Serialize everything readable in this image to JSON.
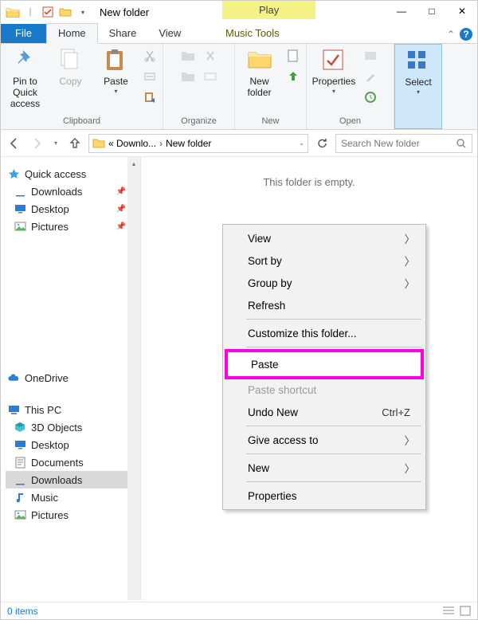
{
  "titlebar": {
    "window_title": "New folder",
    "tools_tab": "Play",
    "controls": {
      "min": "—",
      "max": "□",
      "close": "✕"
    }
  },
  "tabs": {
    "file": "File",
    "home": "Home",
    "share": "Share",
    "view": "View",
    "music_tools": "Music Tools"
  },
  "ribbon": {
    "clipboard": {
      "label": "Clipboard",
      "pin_to_quick": "Pin to Quick access",
      "copy": "Copy",
      "paste": "Paste"
    },
    "organize": {
      "label": "Organize"
    },
    "new": {
      "label": "New",
      "new_folder": "New folder"
    },
    "open": {
      "label": "Open",
      "properties": "Properties"
    },
    "select": {
      "label": "Select"
    }
  },
  "address": {
    "crumbs": [
      "« Downlo...",
      "New folder"
    ],
    "sep": "›"
  },
  "search": {
    "placeholder": "Search New folder"
  },
  "navtree": {
    "quick_access": "Quick access",
    "quick_items": [
      {
        "label": "Downloads"
      },
      {
        "label": "Desktop"
      },
      {
        "label": "Pictures"
      }
    ],
    "onedrive": "OneDrive",
    "this_pc": "This PC",
    "pc_items": [
      {
        "label": "3D Objects"
      },
      {
        "label": "Desktop"
      },
      {
        "label": "Documents"
      },
      {
        "label": "Downloads",
        "selected": true
      },
      {
        "label": "Music"
      },
      {
        "label": "Pictures"
      }
    ]
  },
  "content": {
    "empty_message": "This folder is empty."
  },
  "statusbar": {
    "items": "0 items"
  },
  "context_menu": {
    "view": "View",
    "sort_by": "Sort by",
    "group_by": "Group by",
    "refresh": "Refresh",
    "customize": "Customize this folder...",
    "paste": "Paste",
    "paste_shortcut": "Paste shortcut",
    "undo_new": "Undo New",
    "undo_hotkey": "Ctrl+Z",
    "give_access": "Give access to",
    "new": "New",
    "properties": "Properties"
  }
}
